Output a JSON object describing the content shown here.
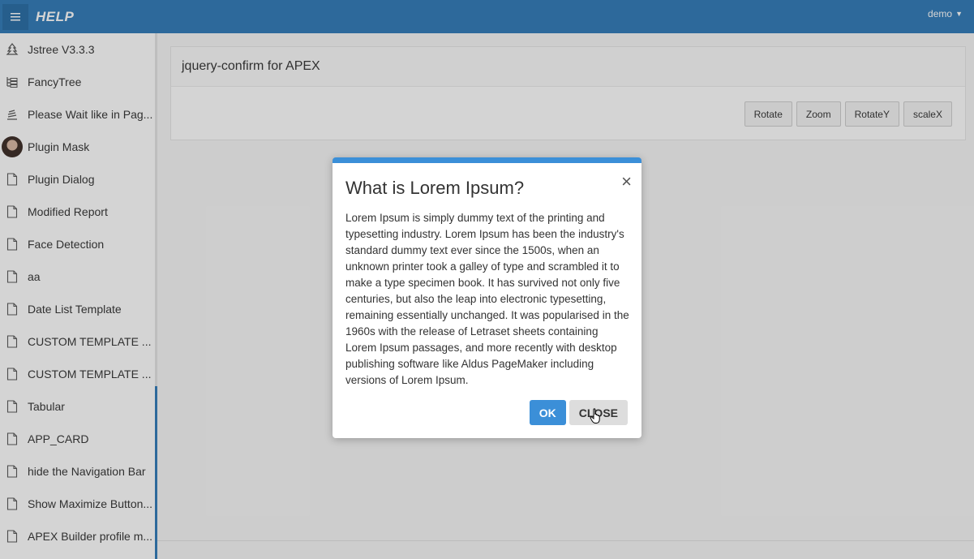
{
  "header": {
    "brand": "HELP",
    "user": "demo",
    "menu_icon": "hamburger-icon"
  },
  "sidebar": {
    "items": [
      {
        "label": "Jstree V3.3.3",
        "icon": "tree-icon"
      },
      {
        "label": "FancyTree",
        "icon": "tree-list-icon"
      },
      {
        "label": "Please Wait like in Pag...",
        "icon": "stack-icon"
      },
      {
        "label": "Plugin Mask",
        "icon": "avatar"
      },
      {
        "label": "Plugin Dialog",
        "icon": "file-icon"
      },
      {
        "label": "Modified Report",
        "icon": "file-icon"
      },
      {
        "label": "Face Detection",
        "icon": "file-icon"
      },
      {
        "label": "aa",
        "icon": "file-icon"
      },
      {
        "label": "Date List Template",
        "icon": "file-icon"
      },
      {
        "label": "CUSTOM TEMPLATE ...",
        "icon": "file-icon"
      },
      {
        "label": "CUSTOM TEMPLATE ...",
        "icon": "file-icon"
      },
      {
        "label": "Tabular",
        "icon": "file-icon"
      },
      {
        "label": "APP_CARD",
        "icon": "file-icon"
      },
      {
        "label": "hide the Navigation Bar",
        "icon": "file-icon"
      },
      {
        "label": "Show Maximize Button...",
        "icon": "file-icon"
      },
      {
        "label": "APEX Builder profile m...",
        "icon": "file-icon"
      }
    ]
  },
  "region": {
    "title": "jquery-confirm for APEX",
    "buttons": [
      "Rotate",
      "Zoom",
      "RotateY",
      "scaleX"
    ]
  },
  "dialog": {
    "title": "What is Lorem Ipsum?",
    "close_symbol": "×",
    "body": "Lorem Ipsum is simply dummy text of the printing and typesetting industry. Lorem Ipsum has been the industry's standard dummy text ever since the 1500s, when an unknown printer took a galley of type and scrambled it to make a type specimen book. It has survived not only five centuries, but also the leap into electronic typesetting, remaining essentially unchanged. It was popularised in the 1960s with the release of Letraset sheets containing Lorem Ipsum passages, and more recently with desktop publishing software like Aldus PageMaker including versions of Lorem Ipsum.",
    "ok_label": "OK",
    "close_label": "CLOSE",
    "accent_color": "#3b8fd8"
  },
  "colors": {
    "header": "#2f7ab8",
    "dialog_accent": "#3b8fd8"
  }
}
